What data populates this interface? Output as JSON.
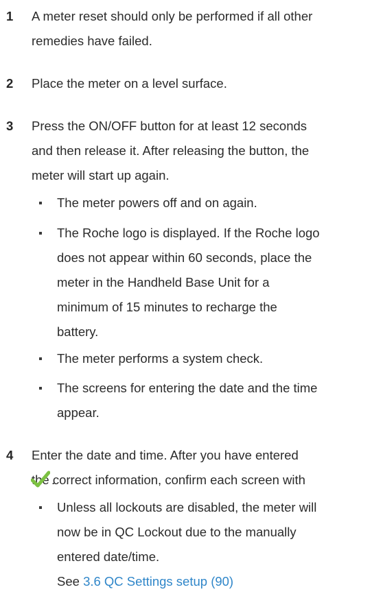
{
  "steps": [
    {
      "number": "1",
      "lines": [
        "A meter reset should only be performed if all other",
        "remedies have failed."
      ]
    },
    {
      "number": "2",
      "lines": [
        "Place the meter on a level surface."
      ]
    },
    {
      "number": "3",
      "lines": [
        "Press the ON/OFF button for at least 12 seconds",
        "and then release it. After releasing the button, the",
        "meter will start up again."
      ],
      "bullets": [
        {
          "lines": [
            "The meter powers off and on again."
          ]
        },
        {
          "lines": [
            "The Roche logo is displayed. If the Roche logo",
            "does not appear within 60 seconds, place the",
            "meter in the Handheld Base Unit for a",
            "minimum of 15 minutes to recharge the",
            "battery."
          ]
        },
        {
          "lines": [
            "The meter performs a system check."
          ]
        },
        {
          "lines": [
            "The screens for entering the date and the time",
            "appear."
          ]
        }
      ]
    },
    {
      "number": "4",
      "lines": [
        "Enter the date and time. After you have entered",
        "the correct information, confirm each screen with"
      ],
      "confirm_icon": "checkmark-icon",
      "confirm_suffix": ".",
      "bullets": [
        {
          "lines": [
            "Unless all lockouts are disabled, the meter will",
            "now be in QC Lockout due to the manually",
            "entered date/time."
          ],
          "see_prefix": "See ",
          "see_link": "3.6 QC Settings setup (90)"
        }
      ]
    }
  ],
  "colors": {
    "text": "#2b2b2b",
    "link": "#2f86c9",
    "check": "#7cc142"
  }
}
